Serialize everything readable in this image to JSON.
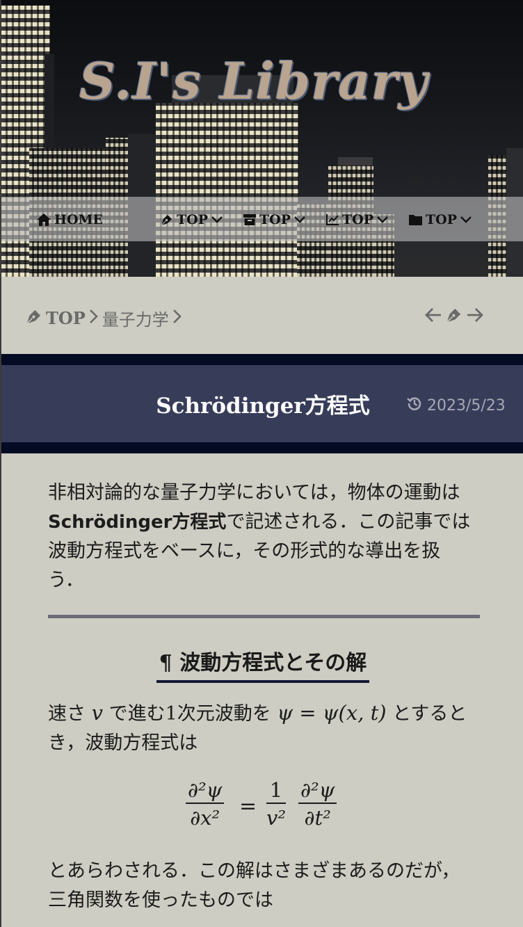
{
  "site": {
    "title": "S.I's Library"
  },
  "nav": {
    "home": "HOME",
    "items": [
      "TOP",
      "TOP",
      "TOP",
      "TOP"
    ]
  },
  "breadcrumb": {
    "top": "TOP",
    "category": "量子力学"
  },
  "post": {
    "title": "Schrödinger方程式",
    "date": "2023/5/23",
    "intro_1": "非相対論的な量子力学においては，物体の運動は",
    "intro_2a": "Schrödinger方程式",
    "intro_2b": "で記述される．この記事では",
    "intro_3": "波動方程式をベースに，その形式的な導出を扱",
    "intro_4": "う．",
    "section_heading": "¶ 波動方程式とその解",
    "para2_1a": "速さ ",
    "para2_1v": "v",
    "para2_1b": " で進む1次元波動を ",
    "para2_1eq": "ψ = ψ(x, t)",
    "para2_1c": " とすると",
    "para2_2": "き，波動方程式は",
    "eq_lhs_num": "∂²ψ",
    "eq_lhs_den": "∂x²",
    "eq_equals": "=",
    "eq_coef_num": "1",
    "eq_coef_den": "v²",
    "eq_rhs_num": "∂²ψ",
    "eq_rhs_den": "∂t²",
    "para3_1": "とあらわされる．この解はさまざまあるのだが，",
    "para3_2": "三角関数を使ったものでは"
  },
  "colors": {
    "background": "#cdcdc3",
    "title_band": "#373c59",
    "title_band_border": "#050b22",
    "nav_bar": "#b9b9b9"
  },
  "icons": [
    "home-icon",
    "pen-icon",
    "archive-icon",
    "chart-line-icon",
    "folder-icon",
    "chevron-down-icon",
    "chevron-right-icon",
    "arrow-left-icon",
    "arrow-right-icon",
    "history-icon"
  ]
}
